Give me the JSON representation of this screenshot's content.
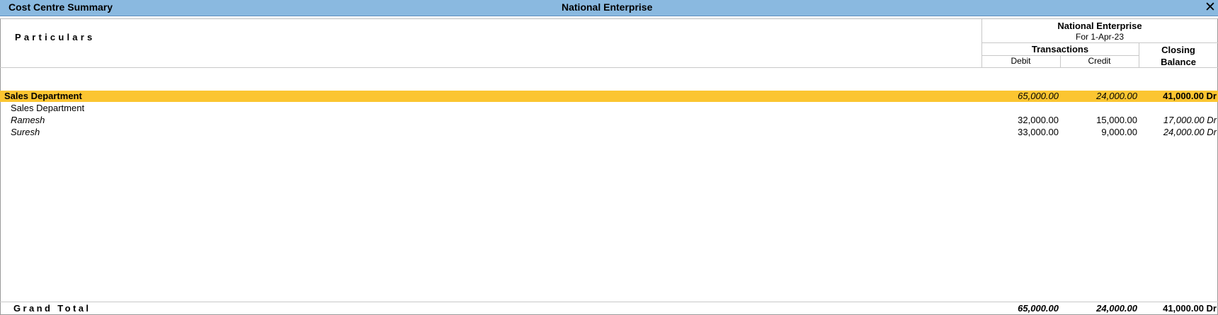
{
  "window": {
    "report_title": "Cost Centre Summary",
    "company_title": "National Enterprise",
    "close_glyph": "✕"
  },
  "header": {
    "particulars": "Particulars",
    "company": "National Enterprise",
    "period": "For 1-Apr-23",
    "transactions": "Transactions",
    "debit": "Debit",
    "credit": "Credit",
    "closing_line1": "Closing",
    "closing_line2": "Balance"
  },
  "rows": [
    {
      "name": "Sales Department",
      "debit": "65,000.00",
      "credit": "24,000.00",
      "closing": "41,000.00 Dr"
    },
    {
      "name": "Sales Department"
    },
    {
      "name": "Ramesh",
      "debit": "32,000.00",
      "credit": "15,000.00",
      "closing": "17,000.00 Dr"
    },
    {
      "name": "Suresh",
      "debit": "33,000.00",
      "credit": "9,000.00",
      "closing": "24,000.00 Dr"
    }
  ],
  "grand_total": {
    "label": "Grand Total",
    "debit": "65,000.00",
    "credit": "24,000.00",
    "closing": "41,000.00 Dr"
  },
  "colors": {
    "titlebar": "#8ab9e0",
    "highlight": "#fbc531"
  }
}
